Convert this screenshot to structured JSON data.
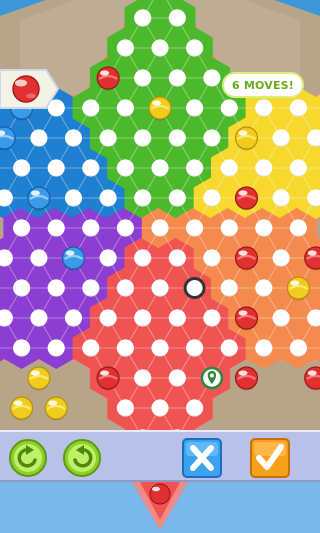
{
  "game": {
    "moves_label": "6 MOVES!",
    "turn_color": "red"
  },
  "colors": {
    "background": "#3d96d8",
    "board_wood": "#b7a58a",
    "star_outline": "#f08a86",
    "zone_top": "#4cb92c",
    "zone_topleft": "#1f7fd0",
    "zone_topright": "#f7d82d",
    "zone_botleft": "#8b3ed1",
    "zone_botright": "#f48a4d",
    "zone_bottom": "#ef5453",
    "marble_red": "#e0302f",
    "marble_blue": "#3a9be8",
    "marble_yellow": "#f2cc1a"
  },
  "toolbar": {
    "undo": "undo-icon",
    "redo": "redo-icon",
    "cancel": "cancel-icon",
    "confirm": "confirm-icon"
  },
  "marbles": [
    {
      "color": "red",
      "q": 1,
      "r": -5
    },
    {
      "color": "red",
      "q": 3,
      "r": -1
    },
    {
      "color": "red",
      "q": 2,
      "r": 1
    },
    {
      "color": "red",
      "q": 4,
      "r": 1
    },
    {
      "color": "red",
      "q": 1,
      "r": 3
    },
    {
      "color": "red",
      "q": 0,
      "r": 5
    },
    {
      "color": "red",
      "q": 2,
      "r": 5
    },
    {
      "color": "red",
      "q": 3,
      "r": 4
    },
    {
      "color": "red",
      "q": -1,
      "r": 8
    },
    {
      "color": "red",
      "q": -4,
      "r": 5
    },
    {
      "color": "blue",
      "q": -2,
      "r": -4
    },
    {
      "color": "blue",
      "q": -5,
      "r": -3
    },
    {
      "color": "blue",
      "q": -3,
      "r": -3
    },
    {
      "color": "blue",
      "q": -3,
      "r": -1
    },
    {
      "color": "blue",
      "q": -3,
      "r": 1
    },
    {
      "color": "blue",
      "q": 6,
      "r": 1
    },
    {
      "color": "yellow",
      "q": 2,
      "r": -4
    },
    {
      "color": "yellow",
      "q": 4,
      "r": -3
    },
    {
      "color": "yellow",
      "q": -6,
      "r": 5
    },
    {
      "color": "yellow",
      "q": -7,
      "r": 6
    },
    {
      "color": "yellow",
      "q": -6,
      "r": 6
    },
    {
      "color": "yellow",
      "q": 3,
      "r": 2
    },
    {
      "color": "yellow",
      "q": 5,
      "r": 0
    }
  ],
  "highlights": [
    {
      "type": "ring",
      "q": 0,
      "r": 2
    },
    {
      "type": "target",
      "q": -1,
      "r": 5
    },
    {
      "type": "ring",
      "q": 6,
      "r": 1
    }
  ]
}
